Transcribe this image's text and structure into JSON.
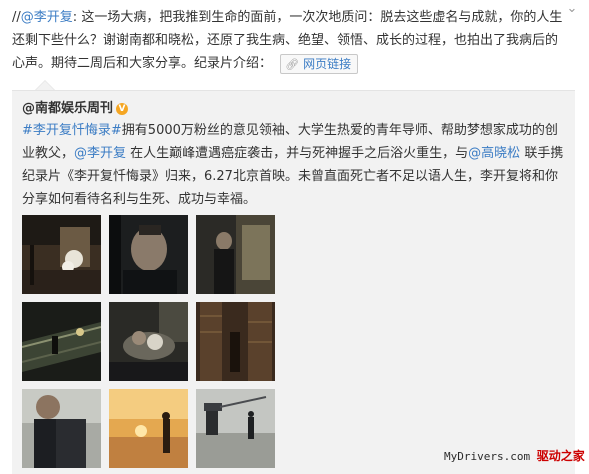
{
  "post": {
    "prefix": "//",
    "mention": "@李开复",
    "colon": ":",
    "body": "这一场大病，把我推到生命的面前，一次次地质问：脱去这些虚名与成就，你的人生还剩下些什么？谢谢南都和晓松，还原了我生病、绝望、领悟、成长的过程，也拍出了我病后的心声。期待二周后和大家分享。纪录片介绍：",
    "web_link_label": "网页链接",
    "web_link_icon": "link-icon"
  },
  "repost": {
    "author": "@南都娱乐周刊",
    "verified_icon": "verified-badge-icon",
    "verified_glyph": "V",
    "hashtag": "#李开复忏悔录#",
    "text1": "拥有5000万粉丝的意见领袖、大学生热爱的青年导师、帮助梦想家成功的创业教父，",
    "mention1": "@李开复",
    "text2": " 在人生巅峰遭遇癌症袭击，并与死神握手之后浴火重生，与",
    "mention2": "@高晓松",
    "text3": " 联手携纪录片《李开复忏悔录》归来，6.27北京首映。未曾直面死亡者不足以语人生，李开复将和你分享如何看待名利与生死、成功与幸福。",
    "images": [
      {
        "name": "photo-1"
      },
      {
        "name": "photo-2"
      },
      {
        "name": "photo-3"
      },
      {
        "name": "photo-4"
      },
      {
        "name": "photo-5"
      },
      {
        "name": "photo-6"
      },
      {
        "name": "photo-7"
      },
      {
        "name": "photo-8"
      },
      {
        "name": "photo-9"
      }
    ]
  },
  "chevron_glyph": "⌄",
  "watermark": {
    "site": "MyDrivers.com",
    "cn": "驱动之家"
  }
}
